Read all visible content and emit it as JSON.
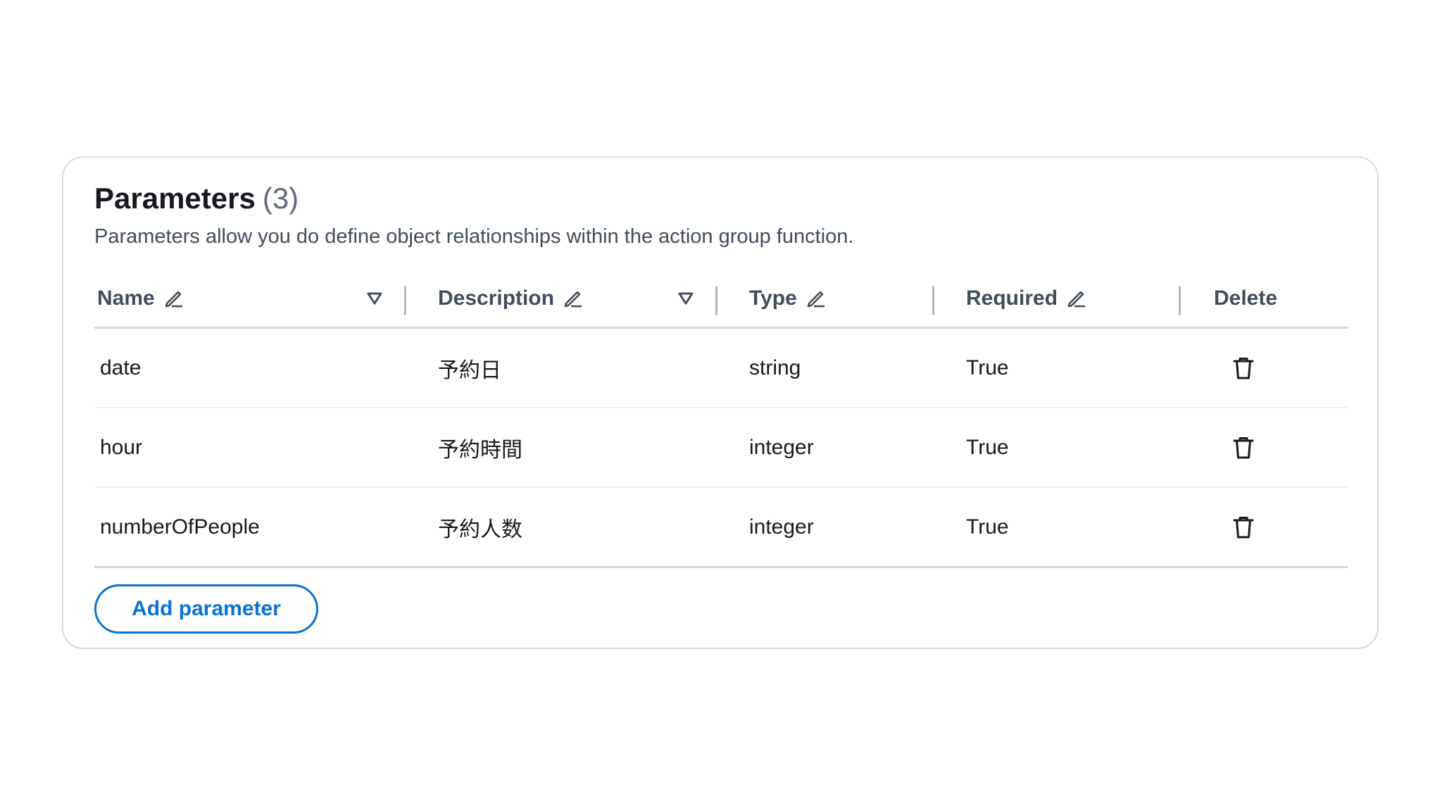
{
  "panel": {
    "title": "Parameters",
    "count": "(3)",
    "description": "Parameters allow you do define object relationships within the action group function."
  },
  "columns": [
    {
      "label": "Name",
      "editable": true,
      "sortable": true
    },
    {
      "label": "Description",
      "editable": true,
      "sortable": true
    },
    {
      "label": "Type",
      "editable": true,
      "sortable": false
    },
    {
      "label": "Required",
      "editable": true,
      "sortable": false
    },
    {
      "label": "Delete",
      "editable": false,
      "sortable": false
    }
  ],
  "rows": [
    {
      "name": "date",
      "description": "予約日",
      "type": "string",
      "required": "True"
    },
    {
      "name": "hour",
      "description": "予約時間",
      "type": "integer",
      "required": "True"
    },
    {
      "name": "numberOfPeople",
      "description": "予約人数",
      "type": "integer",
      "required": "True"
    }
  ],
  "actions": {
    "add_label": "Add parameter"
  },
  "icons": {
    "edit": "pencil-icon",
    "sort": "sort-down-triangle-icon",
    "delete": "trash-icon"
  },
  "colors": {
    "accent": "#0972d3",
    "border": "#d5dbdb",
    "text": "#16191f",
    "muted": "#5f6b7a"
  }
}
